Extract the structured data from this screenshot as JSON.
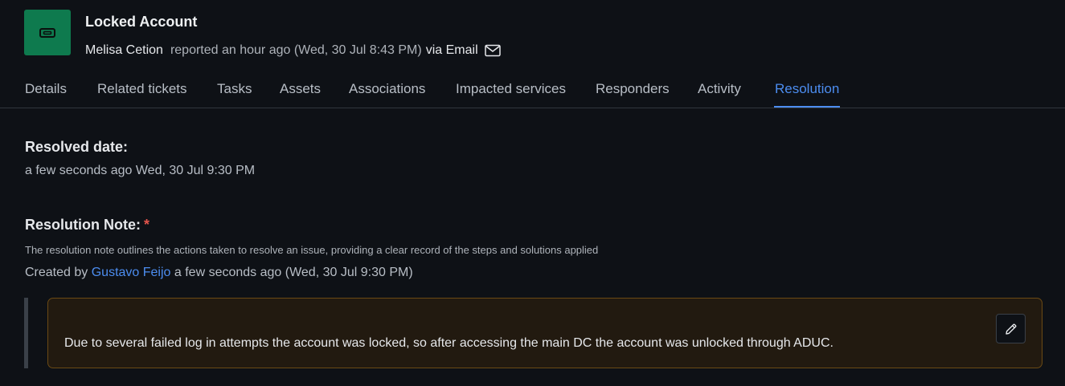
{
  "header": {
    "title": "Locked Account",
    "reporter": "Melisa Cetion",
    "reported": "reported an hour ago (Wed, 30 Jul 8:43 PM)",
    "via": "via Email",
    "icon": "ticket-icon",
    "icon_color": "#0e7a4e"
  },
  "tabs": [
    {
      "label": "Details"
    },
    {
      "label": "Related tickets"
    },
    {
      "label": "Tasks"
    },
    {
      "label": "Assets"
    },
    {
      "label": "Associations"
    },
    {
      "label": "Impacted services"
    },
    {
      "label": "Responders"
    },
    {
      "label": "Activity"
    },
    {
      "label": "Resolution",
      "active": true
    }
  ],
  "resolution": {
    "resolved_label": "Resolved date:",
    "resolved_value": "a few seconds ago Wed, 30 Jul 9:30 PM",
    "note_label": "Resolution Note:",
    "required_mark": "*",
    "help_text": "The resolution note outlines the actions taken to resolve an issue, providing a clear record of the steps and solutions applied",
    "created_prefix": "Created by",
    "created_by": "Gustavo Feijo",
    "created_suffix": "a few seconds ago (Wed, 30 Jul 9:30 PM)",
    "note_text": "Due to several failed log in attempts the account was locked, so after accessing the main DC the account was unlocked through ADUC."
  },
  "colors": {
    "accent": "#4c8df0",
    "required": "#e2544b",
    "note_border": "#6b4a14",
    "note_background": "#221a10"
  }
}
